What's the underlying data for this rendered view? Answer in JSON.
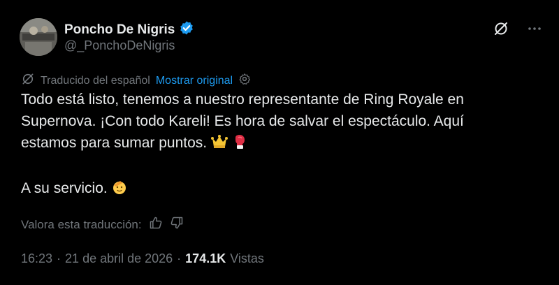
{
  "author": {
    "name": "Poncho De Nigris",
    "handle": "@_PonchoDeNigris",
    "verified_color": "#1d9bf0"
  },
  "translation_bar": {
    "label": "Traducido del español",
    "show_original": "Mostrar original"
  },
  "tweet": {
    "line1": "Todo está listo, tenemos a nuestro representante de Ring Royale en",
    "line2": "Supernova. ¡Con todo Kareli! Es hora de salvar el espectáculo. Aquí",
    "line3": "estamos para sumar puntos.",
    "line4": "A su servicio."
  },
  "rate": {
    "label": "Valora esta traducción:"
  },
  "meta": {
    "time": "16:23",
    "sep1": "·",
    "date": "21 de abril de 2026",
    "sep2": "·",
    "views_count": "174.1K",
    "views_label": "Vistas"
  },
  "icons": [
    "translate-icon",
    "more-icon",
    "translate-small-icon",
    "settings-icon",
    "thumbs-up-icon",
    "thumbs-down-icon",
    "crown-icon",
    "boxing-glove-icon",
    "saluting-face-icon",
    "verified-badge-icon"
  ]
}
